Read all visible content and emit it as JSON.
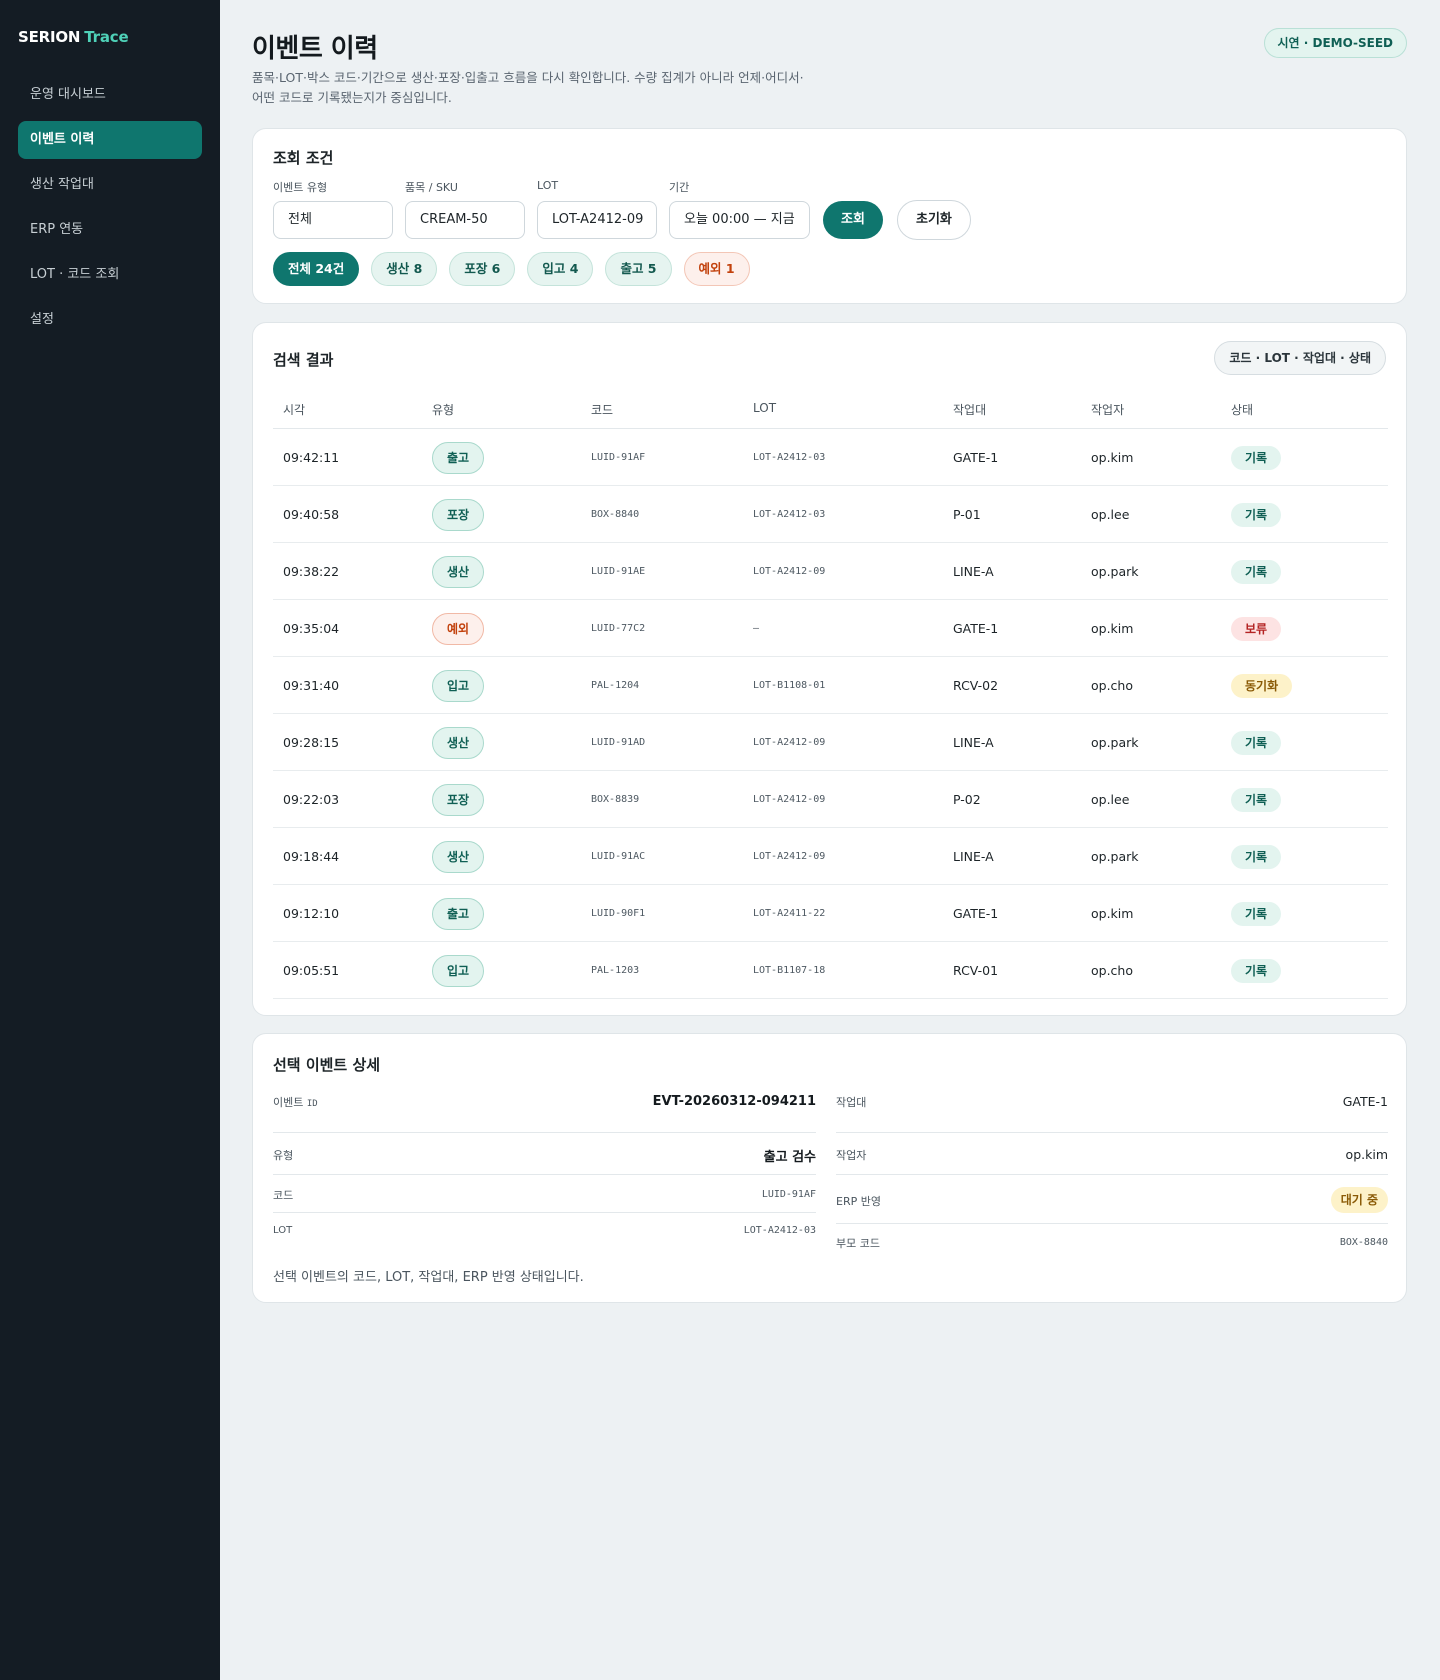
{
  "brand": {
    "name": "SERION",
    "suffix": "Trace"
  },
  "nav": [
    {
      "label": "운영 대시보드",
      "active": false
    },
    {
      "label": "이벤트 이력",
      "active": true
    },
    {
      "label": "생산 작업대",
      "active": false
    },
    {
      "label": "ERP 연동",
      "active": false
    },
    {
      "label": "LOT · 코드 조회",
      "active": false
    },
    {
      "label": "설정",
      "active": false
    }
  ],
  "header": {
    "title": "이벤트 이력",
    "description": "품목·LOT·박스 코드·기간으로 생산·포장·입출고 흐름을 다시 확인합니다. 수량 집계가 아니라 언제·어디서·어떤 코드로 기록됐는지가 중심입니다.",
    "badge": "시연 · DEMO-SEED"
  },
  "filter": {
    "title": "조회 조건",
    "fields": {
      "event_type": {
        "label": "이벤트 유형",
        "value": "전체"
      },
      "sku": {
        "label": "품목 / SKU",
        "value": "CREAM-50"
      },
      "lot": {
        "label": "LOT",
        "value": "LOT-A2412-09"
      },
      "period": {
        "label": "기간",
        "value": "오늘 00:00 — 지금"
      }
    },
    "search_button": "조회",
    "reset_button": "초기화",
    "chips": [
      "전체 24건",
      "생산 8",
      "포장 6",
      "입고 4",
      "출고 5",
      "예외 1"
    ]
  },
  "results": {
    "title": "검색 결과",
    "hint": "코드 · LOT · 작업대 · 상태",
    "columns": [
      "시각",
      "유형",
      "코드",
      "LOT",
      "작업대",
      "작업자",
      "상태"
    ],
    "rows": [
      {
        "time": "09:42:11",
        "type": "출고",
        "code": "LUID-91AF",
        "lot": "LOT-A2412-03",
        "station": "GATE-1",
        "operator": "op.kim",
        "status": "기록"
      },
      {
        "time": "09:40:58",
        "type": "포장",
        "code": "BOX-8840",
        "lot": "LOT-A2412-03",
        "station": "P-01",
        "operator": "op.lee",
        "status": "기록"
      },
      {
        "time": "09:38:22",
        "type": "생산",
        "code": "LUID-91AE",
        "lot": "LOT-A2412-09",
        "station": "LINE-A",
        "operator": "op.park",
        "status": "기록"
      },
      {
        "time": "09:35:04",
        "type": "예외",
        "code": "LUID-77C2",
        "lot": "–",
        "station": "GATE-1",
        "operator": "op.kim",
        "status": "보류"
      },
      {
        "time": "09:31:40",
        "type": "입고",
        "code": "PAL-1204",
        "lot": "LOT-B1108-01",
        "station": "RCV-02",
        "operator": "op.cho",
        "status": "동기화"
      },
      {
        "time": "09:28:15",
        "type": "생산",
        "code": "LUID-91AD",
        "lot": "LOT-A2412-09",
        "station": "LINE-A",
        "operator": "op.park",
        "status": "기록"
      },
      {
        "time": "09:22:03",
        "type": "포장",
        "code": "BOX-8839",
        "lot": "LOT-A2412-09",
        "station": "P-02",
        "operator": "op.lee",
        "status": "기록"
      },
      {
        "time": "09:18:44",
        "type": "생산",
        "code": "LUID-91AC",
        "lot": "LOT-A2412-09",
        "station": "LINE-A",
        "operator": "op.park",
        "status": "기록"
      },
      {
        "time": "09:12:10",
        "type": "출고",
        "code": "LUID-90F1",
        "lot": "LOT-A2411-22",
        "station": "GATE-1",
        "operator": "op.kim",
        "status": "기록"
      },
      {
        "time": "09:05:51",
        "type": "입고",
        "code": "PAL-1203",
        "lot": "LOT-B1107-18",
        "station": "RCV-01",
        "operator": "op.cho",
        "status": "기록"
      }
    ]
  },
  "detail": {
    "title": "선택 이벤트 상세",
    "event_id_label": "이벤트",
    "event_id_suffix": "ID",
    "event_id": "EVT-20260312-094211",
    "type_label": "유형",
    "type": "출고 검수",
    "code_label": "코드",
    "code": "LUID-91AF",
    "lot_label": "LOT",
    "lot": "LOT-A2412-03",
    "station_label": "작업대",
    "station": "GATE-1",
    "operator_label": "작업자",
    "operator": "op.kim",
    "erp_label": "ERP 반영",
    "erp": "대기 중",
    "parent_label": "부모 코드",
    "parent": "BOX-8840",
    "note": "선택 이벤트의 코드, LOT, 작업대, ERP 반영 상태입니다."
  },
  "colors": {
    "sidebar": "#141c24",
    "accent": "#0f766e",
    "brand_accent": "#4fd1b8",
    "warn": "#c2410c",
    "hold": "#b42323",
    "pending": "#8a5a06"
  }
}
